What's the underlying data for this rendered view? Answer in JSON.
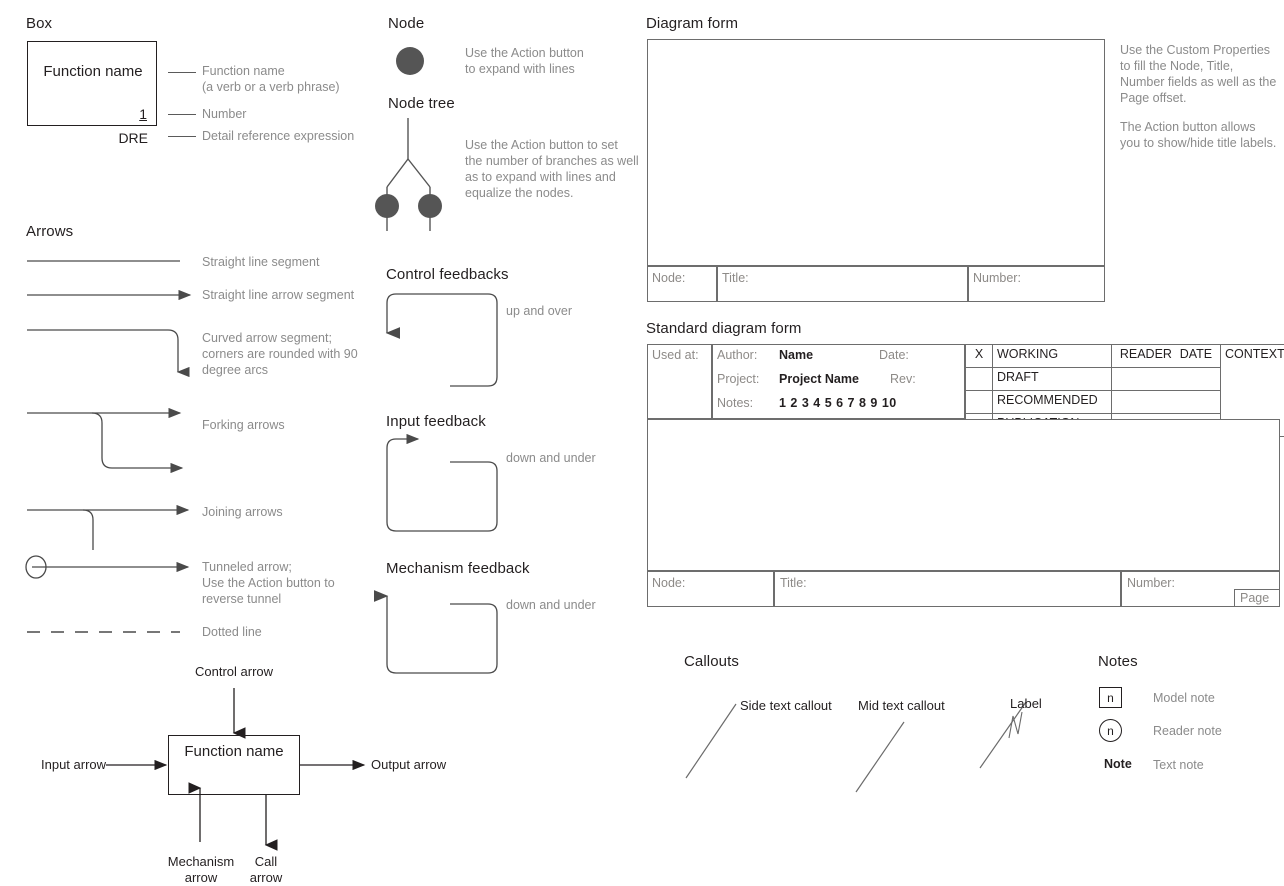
{
  "sections": {
    "box": {
      "title": "Box",
      "function_name": "Function name",
      "number": "1",
      "dre": "DRE",
      "legend": [
        "Function name\n(a verb or a verb phrase)",
        "Number",
        "Detail reference expression"
      ]
    },
    "arrows": {
      "title": "Arrows",
      "items": [
        "Straight line segment",
        "Straight line arrow segment",
        "Curved arrow segment;\ncorners are rounded with 90\ndegree arcs",
        "Forking arrows",
        "Joining arrows",
        "Tunneled arrow;\nUse the Action button to\nreverse tunnel",
        "Dotted line"
      ]
    },
    "node": {
      "title": "Node",
      "description": "Use the Action button\nto expand with lines"
    },
    "node_tree": {
      "title": "Node tree",
      "description": "Use the Action button to set\nthe number of branches as well\nas to expand with lines and\nequalize the nodes."
    },
    "control_feedbacks": {
      "title": "Control feedbacks",
      "caption": "up and over"
    },
    "input_feedback": {
      "title": "Input feedback",
      "caption": "down and under"
    },
    "mechanism_feedback": {
      "title": "Mechanism feedback",
      "caption": "down and under"
    },
    "icom": {
      "function_name": "Function name",
      "control_arrow": "Control arrow",
      "input_arrow": "Input arrow",
      "output_arrow": "Output arrow",
      "mechanism_arrow": "Mechanism\narrow",
      "call_arrow": "Call\narrow"
    },
    "diagram_form": {
      "title": "Diagram form",
      "footer": {
        "node": "Node:",
        "title": "Title:",
        "number": "Number:"
      },
      "notes": [
        "Use the Custom Properties to fill the Node, Title, Number fields as well as the Page offset.",
        "The Action button allows you to show/hide title labels."
      ]
    },
    "standard_form": {
      "title": "Standard diagram form",
      "used_at": "Used at:",
      "author_label": "Author:",
      "author_value": "Name",
      "date_label": "Date:",
      "project_label": "Project:",
      "project_value": "Project Name",
      "rev_label": "Rev:",
      "notes_label": "Notes:",
      "notes_numbers": "1  2  3  4  5  6  7  8  9  10",
      "status_header_x": "X",
      "status_rows": [
        "WORKING",
        "DRAFT",
        "RECOMMENDED",
        "PUBLICATION"
      ],
      "reader": "READER",
      "date": "DATE",
      "context": "CONTEXT:",
      "footer": {
        "node": "Node:",
        "title": "Title:",
        "number": "Number:",
        "page": "Page"
      }
    },
    "callouts": {
      "title": "Callouts",
      "items": [
        "Side text callout",
        "Mid text callout",
        "Label"
      ]
    },
    "notes": {
      "title": "Notes",
      "items": [
        {
          "glyph": "n",
          "label": "Model note"
        },
        {
          "glyph": "n",
          "label": "Reader note"
        },
        {
          "glyph": "Note",
          "label": "Text note"
        }
      ]
    }
  },
  "colors": {
    "ink": "#231f20",
    "gray_text": "#8b8b8b",
    "line": "#4a4a4a",
    "node_fill": "#555555",
    "form_border": "#6d6d6d"
  }
}
